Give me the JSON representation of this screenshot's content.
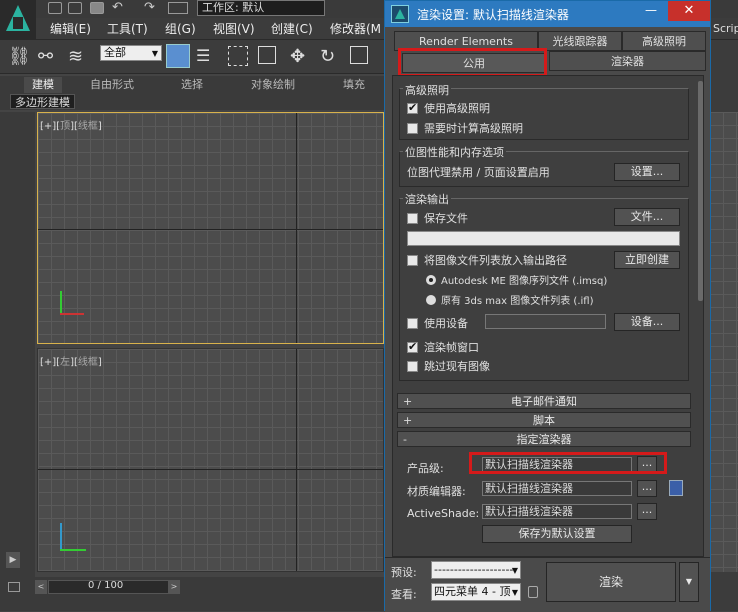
{
  "app": {
    "workspace_label": "工作区: 默认",
    "menus": [
      "编辑(E)",
      "工具(T)",
      "组(G)",
      "视图(V)",
      "创建(C)",
      "修改器(M"
    ],
    "selection_filter": "全部",
    "ribbon_tabs": [
      "建模",
      "自由形式",
      "选择",
      "对象绘制",
      "填充"
    ],
    "poly_label": "多边形建模",
    "viewport_top": {
      "prefix": "[+][",
      "name": "顶",
      "sep": "][",
      "mode": "线框",
      "suffix": "]"
    },
    "viewport_left": {
      "prefix": "[+][",
      "name": "左",
      "sep": "][",
      "mode": "线框",
      "suffix": "]"
    },
    "timeline": "0 / 100",
    "scrip_label": "Scrip"
  },
  "dialog": {
    "title": "渲染设置: 默认扫描线渲染器",
    "close": "✕",
    "tabs_row1": [
      "Render Elements",
      "光线跟踪器",
      "高级照明"
    ],
    "tabs_row2": [
      "公用",
      "渲染器"
    ],
    "group_adv_light": {
      "title": "高级照明",
      "use": "使用高级照明",
      "compute": "需要时计算高级照明"
    },
    "group_bitmap": {
      "title": "位图性能和内存选项",
      "status": "位图代理禁用 / 页面设置启用",
      "button": "设置..."
    },
    "group_output": {
      "title": "渲染输出",
      "save_file": "保存文件",
      "files_button": "文件...",
      "put_list": "将图像文件列表放入输出路径",
      "create_now": "立即创建",
      "radio_autodesk": "Autodesk ME 图像序列文件 (.imsq)",
      "radio_legacy": "原有 3ds max 图像文件列表 (.ifl)",
      "use_device": "使用设备",
      "device_button": "设备...",
      "render_frame_window": "渲染帧窗口",
      "skip_existing": "跳过现有图像"
    },
    "rollouts": [
      {
        "sign": "+",
        "title": "电子邮件通知"
      },
      {
        "sign": "+",
        "title": "脚本"
      },
      {
        "sign": "-",
        "title": "指定渲染器"
      }
    ],
    "assign_renderer": {
      "production_label": "产品级:",
      "production_value": "默认扫描线渲染器",
      "material_label": "材质编辑器:",
      "material_value": "默认扫描线渲染器",
      "activeshade_label": "ActiveShade:",
      "activeshade_value": "默认扫描线渲染器",
      "browse": "...",
      "save_default": "保存为默认设置"
    },
    "bottom": {
      "preset_label": "预设:",
      "preset_value": "--------------------",
      "view_label": "查看:",
      "view_value": "四元菜单 4 - 顶",
      "render_button": "渲染"
    }
  }
}
